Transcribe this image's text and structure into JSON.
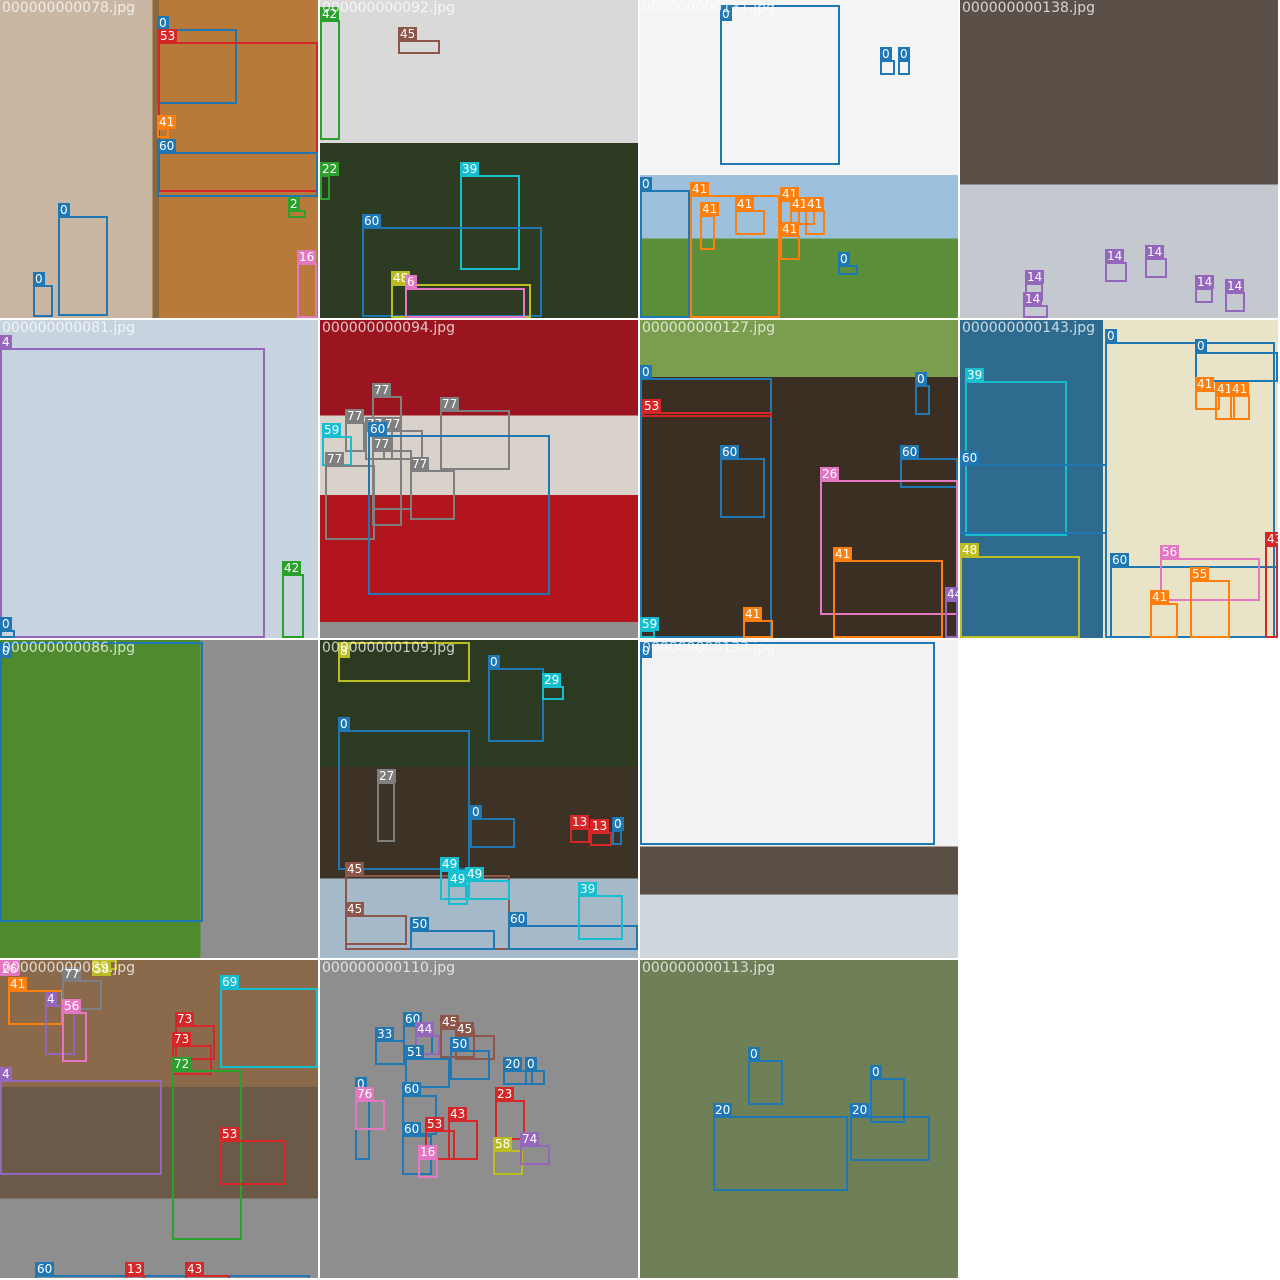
{
  "mosaic": {
    "colors": {
      "0": "#1f77b4",
      "2": "#2ca02c",
      "4": "#9467bd",
      "6": "#e377c2",
      "8": "#bcbd22",
      "13": "#d62728",
      "14": "#9467bd",
      "16": "#e377c2",
      "20": "#1f77b4",
      "22": "#2ca02c",
      "23": "#d62728",
      "26": "#e377c2",
      "27": "#7f7f7f",
      "29": "#17becf",
      "39": "#17becf",
      "41": "#ff7f0e",
      "42": "#2ca02c",
      "43": "#d62728",
      "44": "#9467bd",
      "45": "#8c564b",
      "48": "#bcbd22",
      "49": "#17becf",
      "50": "#1f77b4",
      "53": "#d62728",
      "55": "#ff7f0e",
      "56": "#e377c2",
      "58": "#bcbd22",
      "59": "#17becf",
      "60": "#1f77b4",
      "69": "#17becf",
      "72": "#2ca02c",
      "73": "#d62728",
      "74": "#9467bd",
      "76": "#e377c2",
      "77": "#7f7f7f"
    },
    "tiles": [
      {
        "filename": "000000000078.jpg",
        "labels": [
          "0",
          "53",
          "41",
          "60",
          "0",
          "0",
          "2",
          "16"
        ]
      },
      {
        "filename": "000000000092.jpg",
        "labels": [
          "42",
          "45",
          "22",
          "39",
          "60",
          "48",
          "6"
        ]
      },
      {
        "filename": "000000000131.jpg",
        "labels": [
          "0",
          "0",
          "0",
          "0",
          "41",
          "41",
          "41",
          "41",
          "41",
          "41",
          "41",
          "0"
        ]
      },
      {
        "filename": "000000000138.jpg",
        "labels": [
          "14",
          "14",
          "14",
          "14",
          "14",
          "14"
        ]
      },
      {
        "filename": "000000000081.jpg",
        "labels": [
          "4",
          "42",
          "0"
        ]
      },
      {
        "filename": "000000000094.jpg",
        "labels": [
          "77",
          "77",
          "77",
          "77",
          "77",
          "77",
          "77",
          "59",
          "77",
          "60"
        ]
      },
      {
        "filename": "000000000127.jpg",
        "labels": [
          "0",
          "53",
          "0",
          "60",
          "60",
          "26",
          "41",
          "41",
          "44",
          "59"
        ]
      },
      {
        "filename": "000000000143.jpg",
        "labels": [
          "0",
          "0",
          "39",
          "41",
          "41",
          "41",
          "60",
          "48",
          "60",
          "56",
          "55",
          "41",
          "43"
        ]
      },
      {
        "filename": "000000000086.jpg",
        "labels": [
          "0"
        ]
      },
      {
        "filename": "000000000109.jpg",
        "labels": [
          "8",
          "0",
          "29",
          "0",
          "27",
          "0",
          "13",
          "13",
          "0",
          "45",
          "49",
          "49",
          "49",
          "45",
          "50",
          "60",
          "39"
        ]
      },
      {
        "filename": "000000000133.jpg",
        "labels": [
          "0"
        ]
      },
      {
        "filename": "000000000089.jpg",
        "labels": [
          "26",
          "60",
          "58",
          "13",
          "43",
          "41",
          "77",
          "4",
          "56",
          "73",
          "73",
          "72",
          "69",
          "4",
          "53"
        ]
      },
      {
        "filename": "000000000110.jpg",
        "labels": [
          "60",
          "44",
          "45",
          "33",
          "45",
          "50",
          "51",
          "0",
          "60",
          "76",
          "60",
          "53",
          "43",
          "16",
          "20",
          "0",
          "23",
          "58",
          "74"
        ]
      },
      {
        "filename": "000000000113.jpg",
        "labels": [
          "0",
          "0",
          "20",
          "20"
        ]
      }
    ]
  }
}
